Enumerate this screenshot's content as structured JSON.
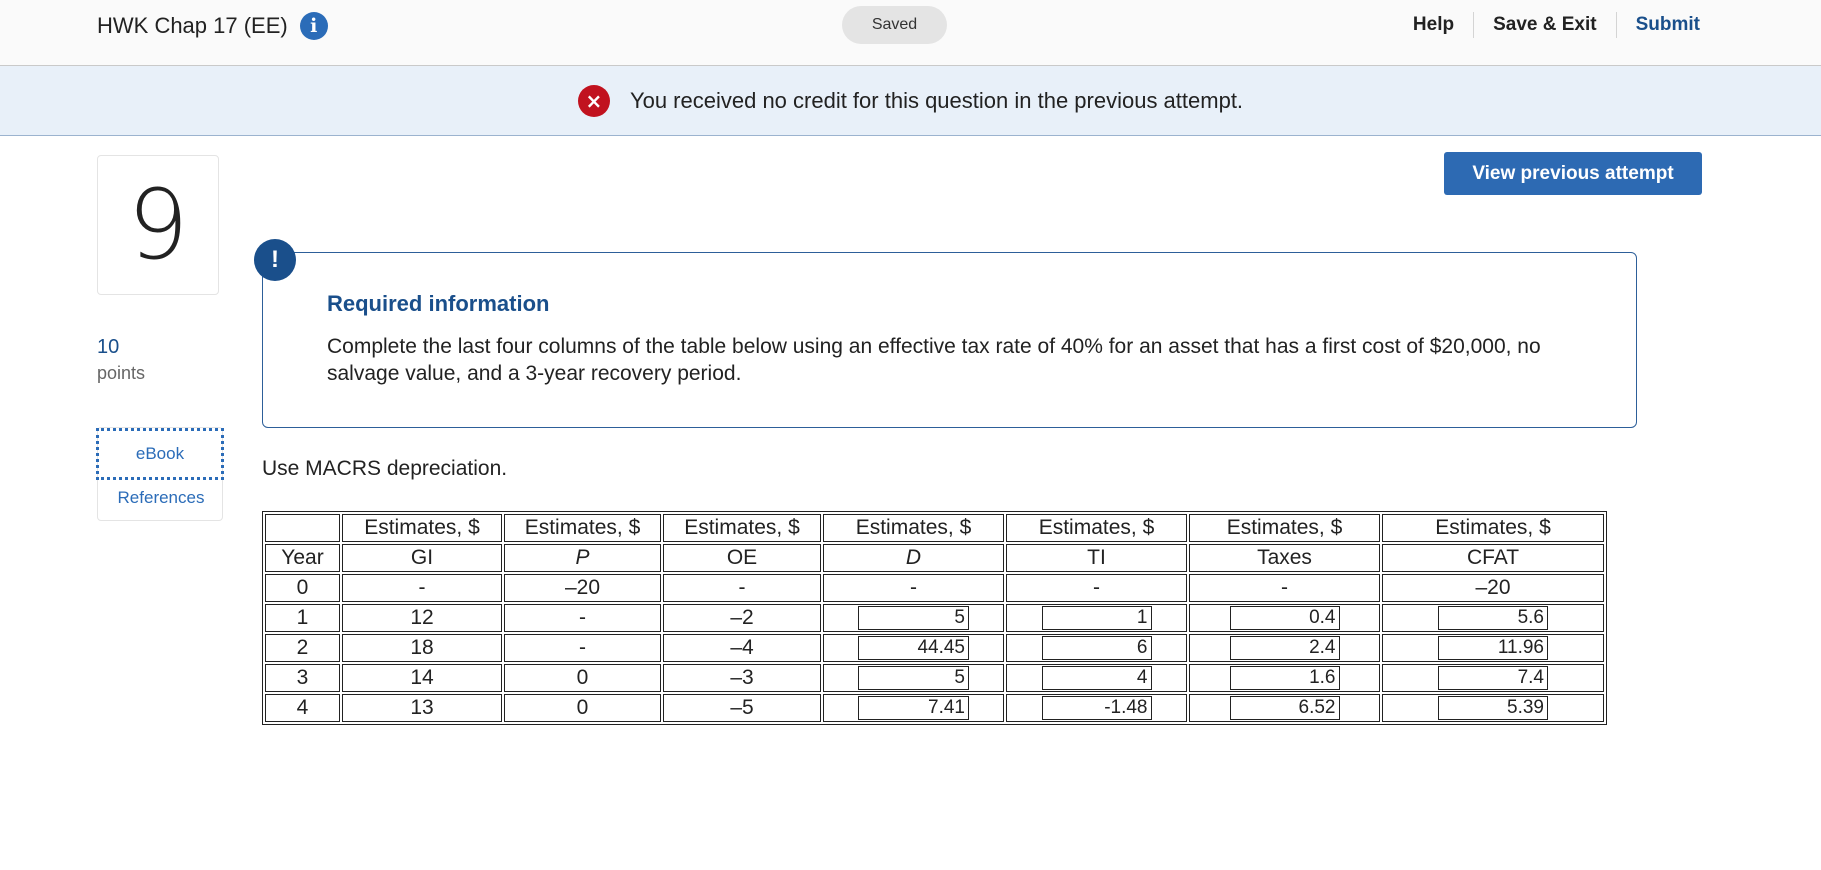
{
  "header": {
    "assignment_title": "HWK Chap 17 (EE)",
    "info_icon": "i",
    "saved_label": "Saved",
    "nav": [
      "Help",
      "Save & Exit",
      "Submit"
    ]
  },
  "banner": {
    "message": "You received no credit for this question in the previous attempt.",
    "icon": "×"
  },
  "question": {
    "number": "9",
    "points_value": "10",
    "points_label": "points",
    "ebook_label": "eBook",
    "references_label": "References",
    "view_previous_label": "View previous attempt"
  },
  "required_info": {
    "badge": "!",
    "title": "Required information",
    "text": "Complete the last four columns of the table below using an effective tax rate of 40% for an asset that has a first cost of $20,000, no salvage value, and a 3-year recovery period."
  },
  "instruction": "Use MACRS depreciation.",
  "table": {
    "group_header": "Estimates, $",
    "columns": [
      "Year",
      "GI",
      "P",
      "OE",
      "D",
      "TI",
      "Taxes",
      "CFAT"
    ],
    "rows": [
      {
        "year": "0",
        "gi": "-",
        "p": "–20",
        "oe": "-",
        "d": "-",
        "ti": "-",
        "taxes": "-",
        "cfat": "–20"
      },
      {
        "year": "1",
        "gi": "12",
        "p": "-",
        "oe": "–2",
        "d": "5",
        "ti": "1",
        "taxes": "0.4",
        "cfat": "5.6"
      },
      {
        "year": "2",
        "gi": "18",
        "p": "-",
        "oe": "–4",
        "d": "44.45",
        "ti": "6",
        "taxes": "2.4",
        "cfat": "11.96"
      },
      {
        "year": "3",
        "gi": "14",
        "p": "0",
        "oe": "–3",
        "d": "5",
        "ti": "4",
        "taxes": "1.6",
        "cfat": "7.4"
      },
      {
        "year": "4",
        "gi": "13",
        "p": "0",
        "oe": "–5",
        "d": "7.41",
        "ti": "-1.48",
        "taxes": "6.52",
        "cfat": "5.39"
      }
    ]
  }
}
